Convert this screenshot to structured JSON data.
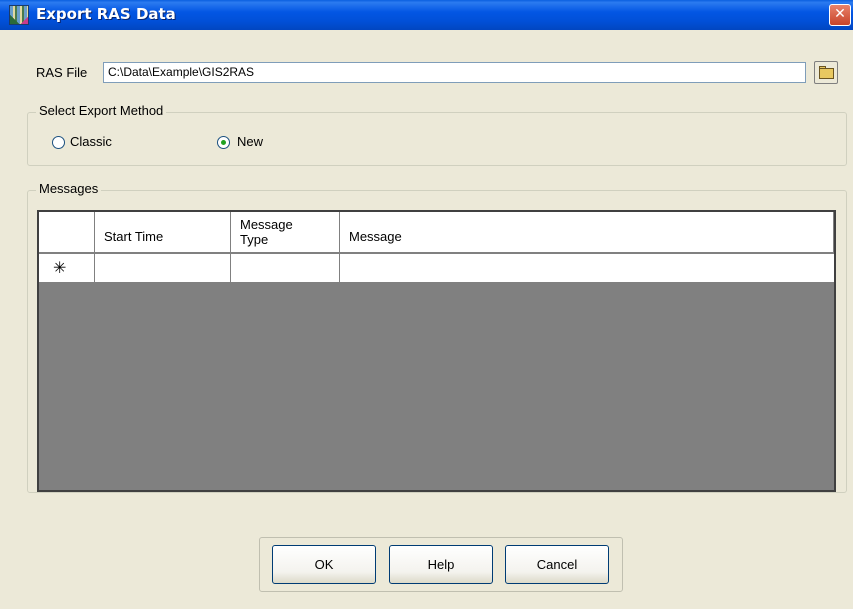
{
  "window": {
    "title": "Export RAS Data",
    "close_label": "✕",
    "app_icon": "ras-app-icon"
  },
  "rasfile": {
    "label": "RAS File",
    "value": "C:\\Data\\Example\\GIS2RAS",
    "browse_icon": "open-folder-icon"
  },
  "export_method": {
    "legend": "Select Export Method",
    "options": [
      {
        "label": "Classic",
        "checked": false
      },
      {
        "label": "New",
        "checked": true
      }
    ]
  },
  "messages": {
    "legend": "Messages",
    "columns": [
      "",
      "Start Time",
      "Message\nType",
      "Message"
    ],
    "new_row_glyph": "✳"
  },
  "buttons": {
    "ok": "OK",
    "help": "Help",
    "cancel": "Cancel"
  }
}
